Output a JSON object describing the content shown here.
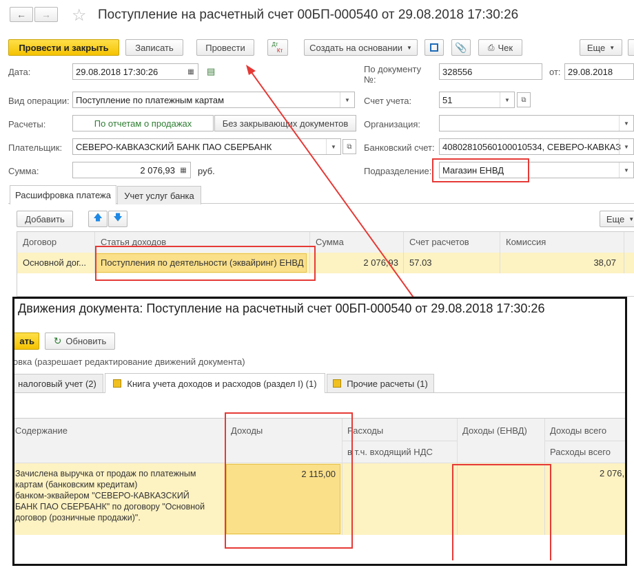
{
  "form": {
    "title": "Поступление на расчетный счет 00БП-000540 от 29.08.2018 17:30:26",
    "toolbar": {
      "post_close": "Провести и закрыть",
      "save": "Записать",
      "post": "Провести",
      "dtkt_top": "Дт",
      "dtkt_bottom": "Кт",
      "create_based": "Создать на основании",
      "check": "Чек",
      "more": "Еще"
    },
    "fields": {
      "date_label": "Дата:",
      "date_value": "29.08.2018 17:30:26",
      "operation_label": "Вид операции:",
      "operation_value": "Поступление по платежным картам",
      "settlements_label": "Расчеты:",
      "settlements_opt1": "По отчетам о продажах",
      "settlements_opt2": "Без закрывающих документов",
      "payer_label": "Плательщик:",
      "payer_value": "СЕВЕРО-КАВКАЗСКИЙ БАНК ПАО СБЕРБАНК",
      "sum_label": "Сумма:",
      "sum_value": "2 076,93",
      "sum_currency": "руб.",
      "doc_label_1": "По документу",
      "doc_label_2": "№:",
      "doc_value": "328556",
      "from_label": "от:",
      "from_value": "29.08.2018",
      "account_label": "Счет учета:",
      "account_value": "51",
      "org_label": "Организация:",
      "org_value": "",
      "bank_label": "Банковский счет:",
      "bank_value": "40802810560100010534, СЕВЕРО-КАВКАЗ",
      "dept_label": "Подразделение:",
      "dept_value": "Магазин ЕНВД"
    },
    "tabs": [
      "Расшифровка платежа",
      "Учет услуг банка"
    ],
    "table_toolbar": {
      "add": "Добавить",
      "more": "Еще"
    },
    "table": {
      "headers": [
        "Договор",
        "Статья доходов",
        "Сумма",
        "Счет расчетов",
        "Комиссия"
      ],
      "row": [
        "Основной дог...",
        "Поступления по деятельности (эквайринг) ЕНВД",
        "2 076,93",
        "57.03",
        "38,07"
      ]
    }
  },
  "movements": {
    "title": "Движения документа: Поступление на расчетный счет 00БП-000540 от 29.08.2018 17:30:26",
    "write_btn_partial": "ать",
    "refresh": "Обновить",
    "note": "овка (разрешает редактирование движений документа)",
    "tabs": [
      "налоговый учет (2)",
      "Книга учета доходов и расходов (раздел I) (1)",
      "Прочие расчеты (1)"
    ],
    "headers": {
      "content": "Содержание",
      "income": "Доходы",
      "expenses": "Расходы",
      "vat": "в т.ч. входящий НДС",
      "income_envd": "Доходы (ЕНВД)",
      "income_total": "Доходы всего",
      "expenses_total": "Расходы всего"
    },
    "row": {
      "content_lines": [
        "Зачислена выручка от продаж по платежным",
        "картам (банковским кредитам)",
        "банком-эквайером \"СЕВЕРО-КАВКАЗСКИЙ",
        "БАНК ПАО СБЕРБАНК\" по договору \"Основной",
        "договор (розничные продажи)\"."
      ],
      "income": "2 115,00",
      "income_total": "2 076,"
    }
  },
  "colors": {
    "highlight_row": "#fdf2c2",
    "highlight_cell": "#fbe08a",
    "annotation": "#e53935"
  }
}
